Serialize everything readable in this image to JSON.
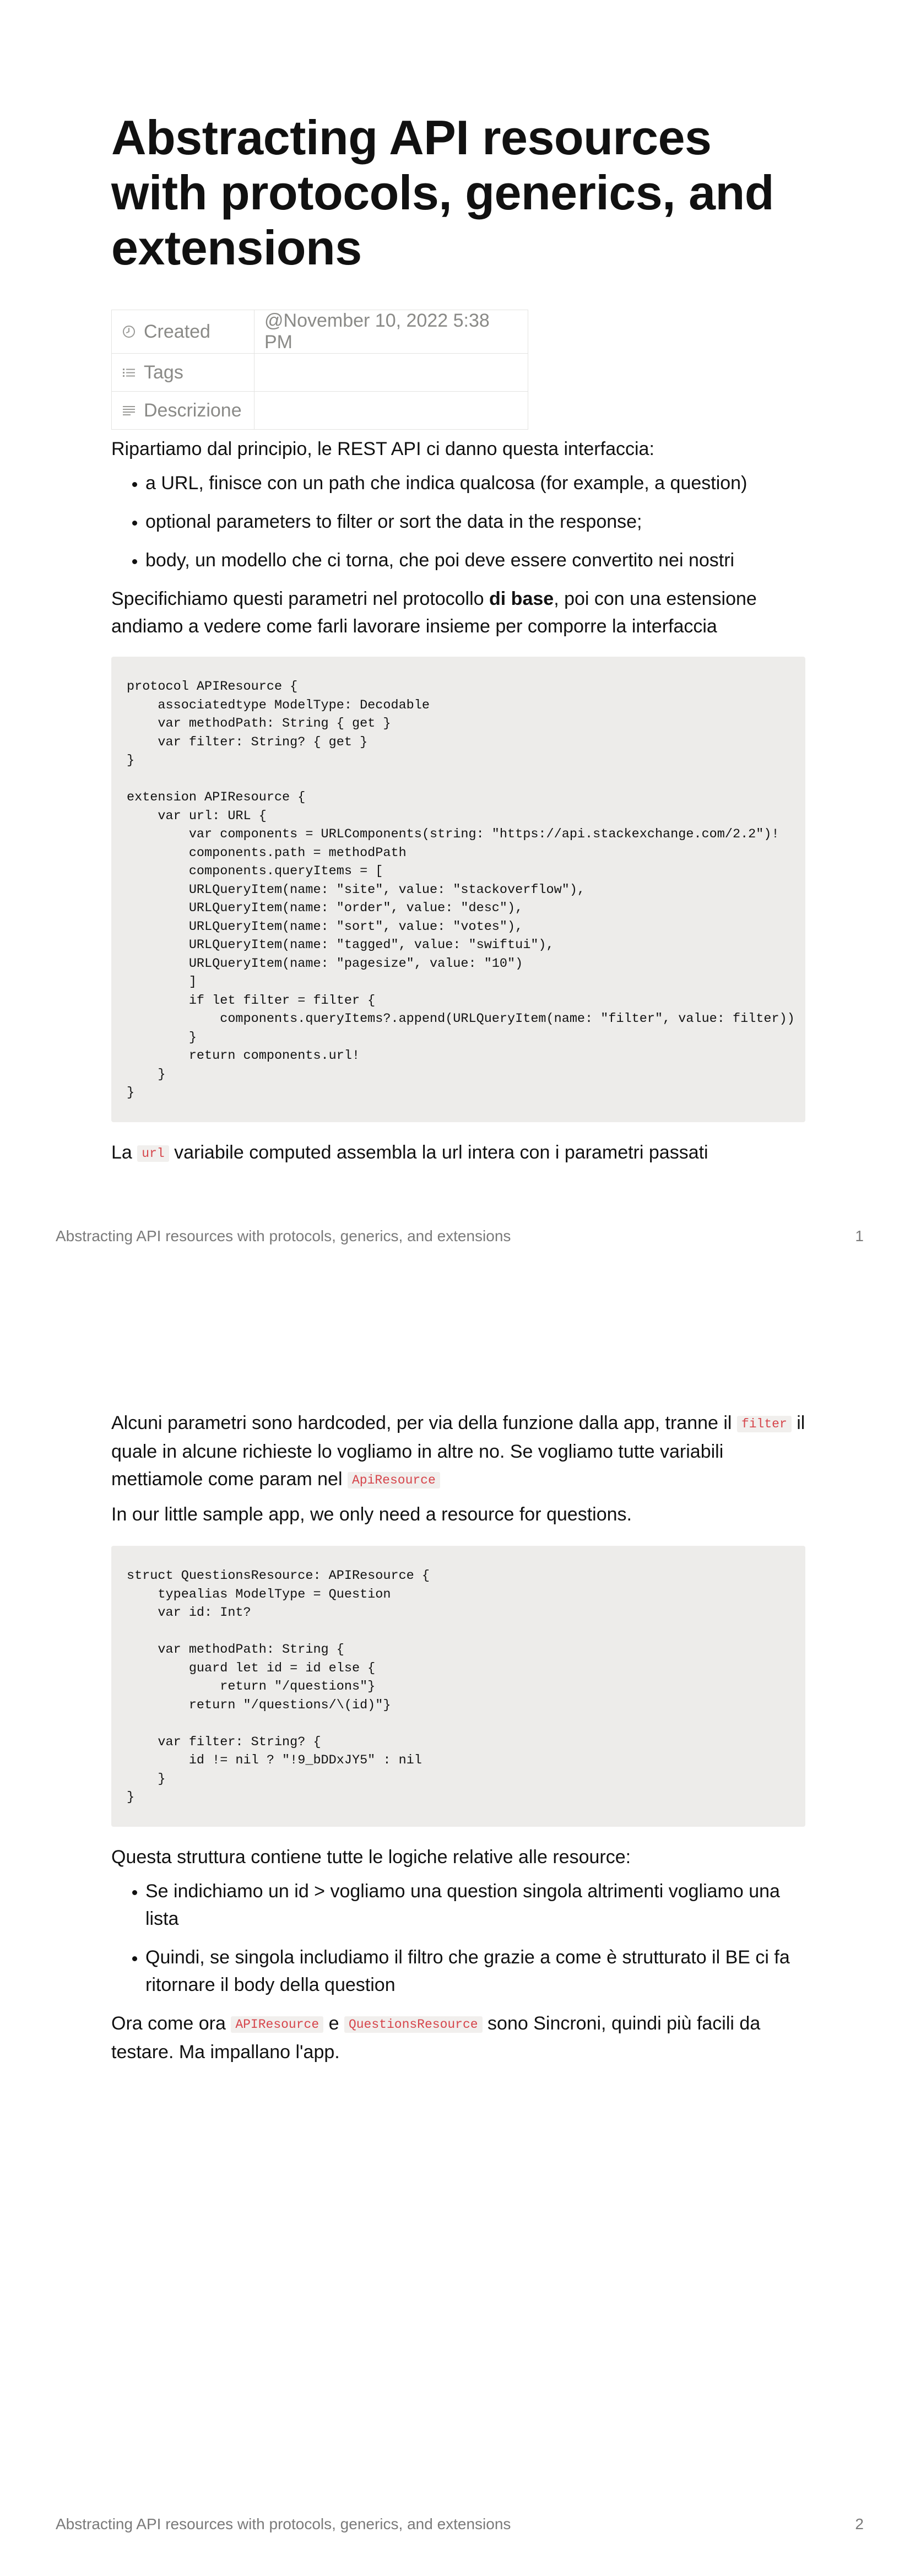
{
  "doc_title": "Abstracting API resources with protocols, generics, and extensions",
  "properties": [
    {
      "icon": "clock-icon",
      "key": "Created",
      "value": "@November 10, 2022 5:38 PM"
    },
    {
      "icon": "list-icon",
      "key": "Tags",
      "value": ""
    },
    {
      "icon": "text-lines-icon",
      "key": "Descrizione",
      "value": ""
    }
  ],
  "page1": {
    "intro": "Ripartiamo dal principio, le REST API ci danno questa interfaccia:",
    "bullets": [
      "a URL, finisce con un path che indica qualcosa (for example, a question)",
      "optional parameters to filter or sort the data in the response;",
      "body, un modello che ci torna, che poi deve essere convertito nei nostri"
    ],
    "spec_before": "Specifichiamo questi parametri nel protocollo ",
    "spec_bold": "di base",
    "spec_after": ", poi con una estensione andiamo a vedere come farli lavorare insieme per comporre la interfaccia",
    "code": "protocol APIResource {\n    associatedtype ModelType: Decodable\n    var methodPath: String { get }\n    var filter: String? { get }\n}\n\nextension APIResource {\n    var url: URL {\n        var components = URLComponents(string: \"https://api.stackexchange.com/2.2\")!\n        components.path = methodPath\n        components.queryItems = [\n        URLQueryItem(name: \"site\", value: \"stackoverflow\"),\n        URLQueryItem(name: \"order\", value: \"desc\"),\n        URLQueryItem(name: \"sort\", value: \"votes\"),\n        URLQueryItem(name: \"tagged\", value: \"swiftui\"),\n        URLQueryItem(name: \"pagesize\", value: \"10\")\n        ]\n        if let filter = filter {\n            components.queryItems?.append(URLQueryItem(name: \"filter\", value: filter))\n        }\n        return components.url!\n    }\n}",
    "url_before": "La ",
    "url_code": "url",
    "url_after": " variabile computed assembla la url intera con i parametri passati"
  },
  "page2": {
    "p1_before": "Alcuni parametri sono hardcoded, per via della funzione dalla app, tranne il ",
    "p1_code1": "filter",
    "p1_mid": " il quale in alcune richieste lo vogliamo in altre no. Se vogliamo tutte variabili mettiamole come param nel ",
    "p1_code2": "ApiResource",
    "p2": "In our little sample app, we only need a resource for questions.",
    "code": "struct QuestionsResource: APIResource {\n    typealias ModelType = Question\n    var id: Int?\n\n    var methodPath: String {\n        guard let id = id else {\n            return \"/questions\"}\n        return \"/questions/\\(id)\"}\n\n    var filter: String? {\n        id != nil ? \"!9_bDDxJY5\" : nil\n    }\n}",
    "p3": "Questa struttura contiene tutte le logiche relative alle resource:",
    "bullets": [
      "Se indichiamo un id > vogliamo una question singola altrimenti vogliamo una lista",
      "Quindi, se singola includiamo il filtro che grazie a come è strutturato il BE ci fa ritornare il body della question"
    ],
    "p4_before": "Ora come ora ",
    "p4_code1": "APIResource",
    "p4_mid": " e ",
    "p4_code2": "QuestionsResource",
    "p4_after": " sono Sincroni, quindi più facili da testare. Ma impallano l'app."
  },
  "footer": {
    "title": "Abstracting API resources with protocols, generics, and extensions",
    "page1_number": "1",
    "page2_number": "2"
  }
}
